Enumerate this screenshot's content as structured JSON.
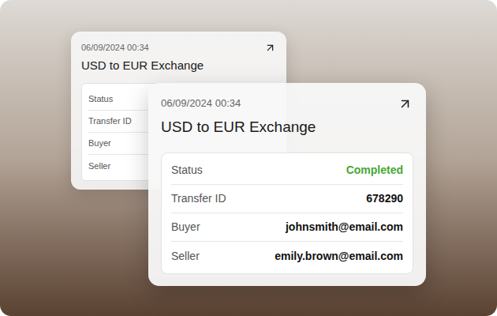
{
  "cards": [
    {
      "position": "back",
      "date": "06/09/2024 00:34",
      "title": "USD to EUR Exchange",
      "rows": [
        {
          "label": "Status"
        },
        {
          "label": "Transfer ID"
        },
        {
          "label": "Buyer"
        },
        {
          "label": "Seller"
        }
      ]
    },
    {
      "position": "front",
      "date": "06/09/2024 00:34",
      "title": "USD to EUR Exchange",
      "rows": [
        {
          "label": "Status",
          "value": "Completed",
          "color": "#45a833"
        },
        {
          "label": "Transfer ID",
          "value": "678290",
          "color": "#111111"
        },
        {
          "label": "Buyer",
          "value": "johnsmith@email.com",
          "color": "#111111"
        },
        {
          "label": "Seller",
          "value": "emily.brown@email.com",
          "color": "#111111"
        }
      ]
    }
  ]
}
